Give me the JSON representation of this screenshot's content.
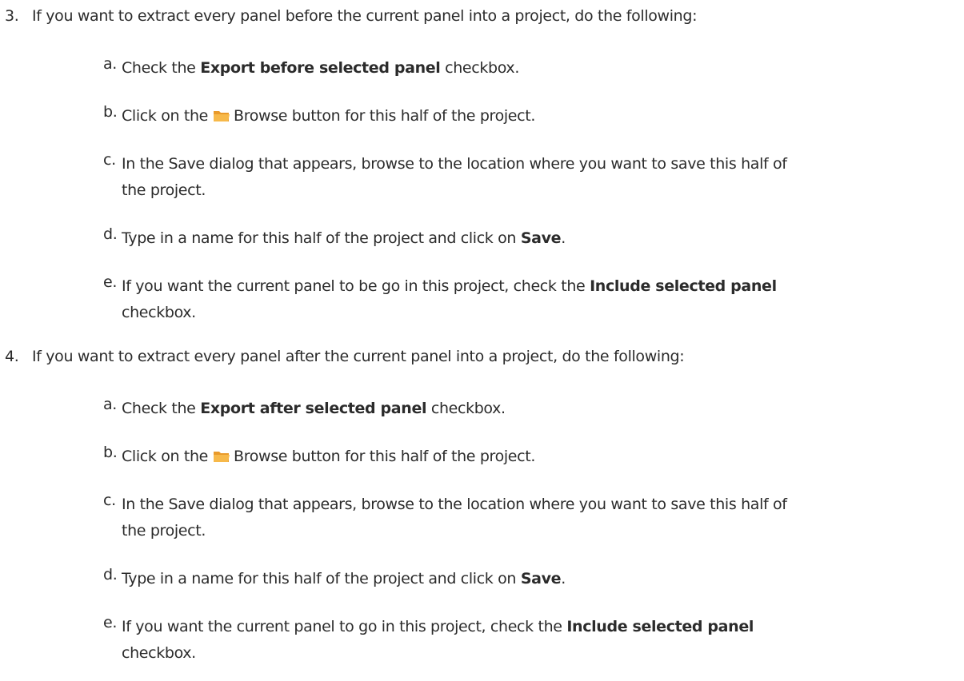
{
  "steps": [
    {
      "number": "3.",
      "text": "If you want to extract every panel before the current panel into a project, do the following:",
      "substeps": [
        {
          "letter": "a.",
          "pre": "Check the ",
          "bold": "Export before selected panel",
          "post": " checkbox."
        },
        {
          "letter": "b.",
          "pre": "Click on the",
          "icon": "folder-icon",
          "post": "Browse button for this half of the project."
        },
        {
          "letter": "c.",
          "line1": "In the Save dialog that appears, browse to the location where you want to save this half of",
          "line2": "the project."
        },
        {
          "letter": "d.",
          "pre": "Type in a name for this half of the project and click on ",
          "bold": "Save",
          "post": "."
        },
        {
          "letter": "e.",
          "pre": "If you want the current panel to be go in this project, check the ",
          "bold": "Include selected panel",
          "line2": "checkbox."
        }
      ]
    },
    {
      "number": "4.",
      "text": "If you want to extract every panel after the current panel into a project, do the following:",
      "substeps": [
        {
          "letter": "a.",
          "pre": "Check the ",
          "bold": "Export after selected panel",
          "post": " checkbox."
        },
        {
          "letter": "b.",
          "pre": "Click on the",
          "icon": "folder-icon",
          "post": "Browse button for this half of the project."
        },
        {
          "letter": "c.",
          "line1": "In the Save dialog that appears, browse to the location where you want to save this half of",
          "line2": "the project."
        },
        {
          "letter": "d.",
          "pre": "Type in a name for this half of the project and click on ",
          "bold": "Save",
          "post": "."
        },
        {
          "letter": "e.",
          "pre": "If you want the current panel to go in this project, check the ",
          "bold": "Include selected panel",
          "line2": "checkbox."
        }
      ]
    }
  ],
  "colors": {
    "text": "#2b2b2b",
    "folder_fill": "#f7b94a",
    "folder_tab": "#e99a2a"
  }
}
